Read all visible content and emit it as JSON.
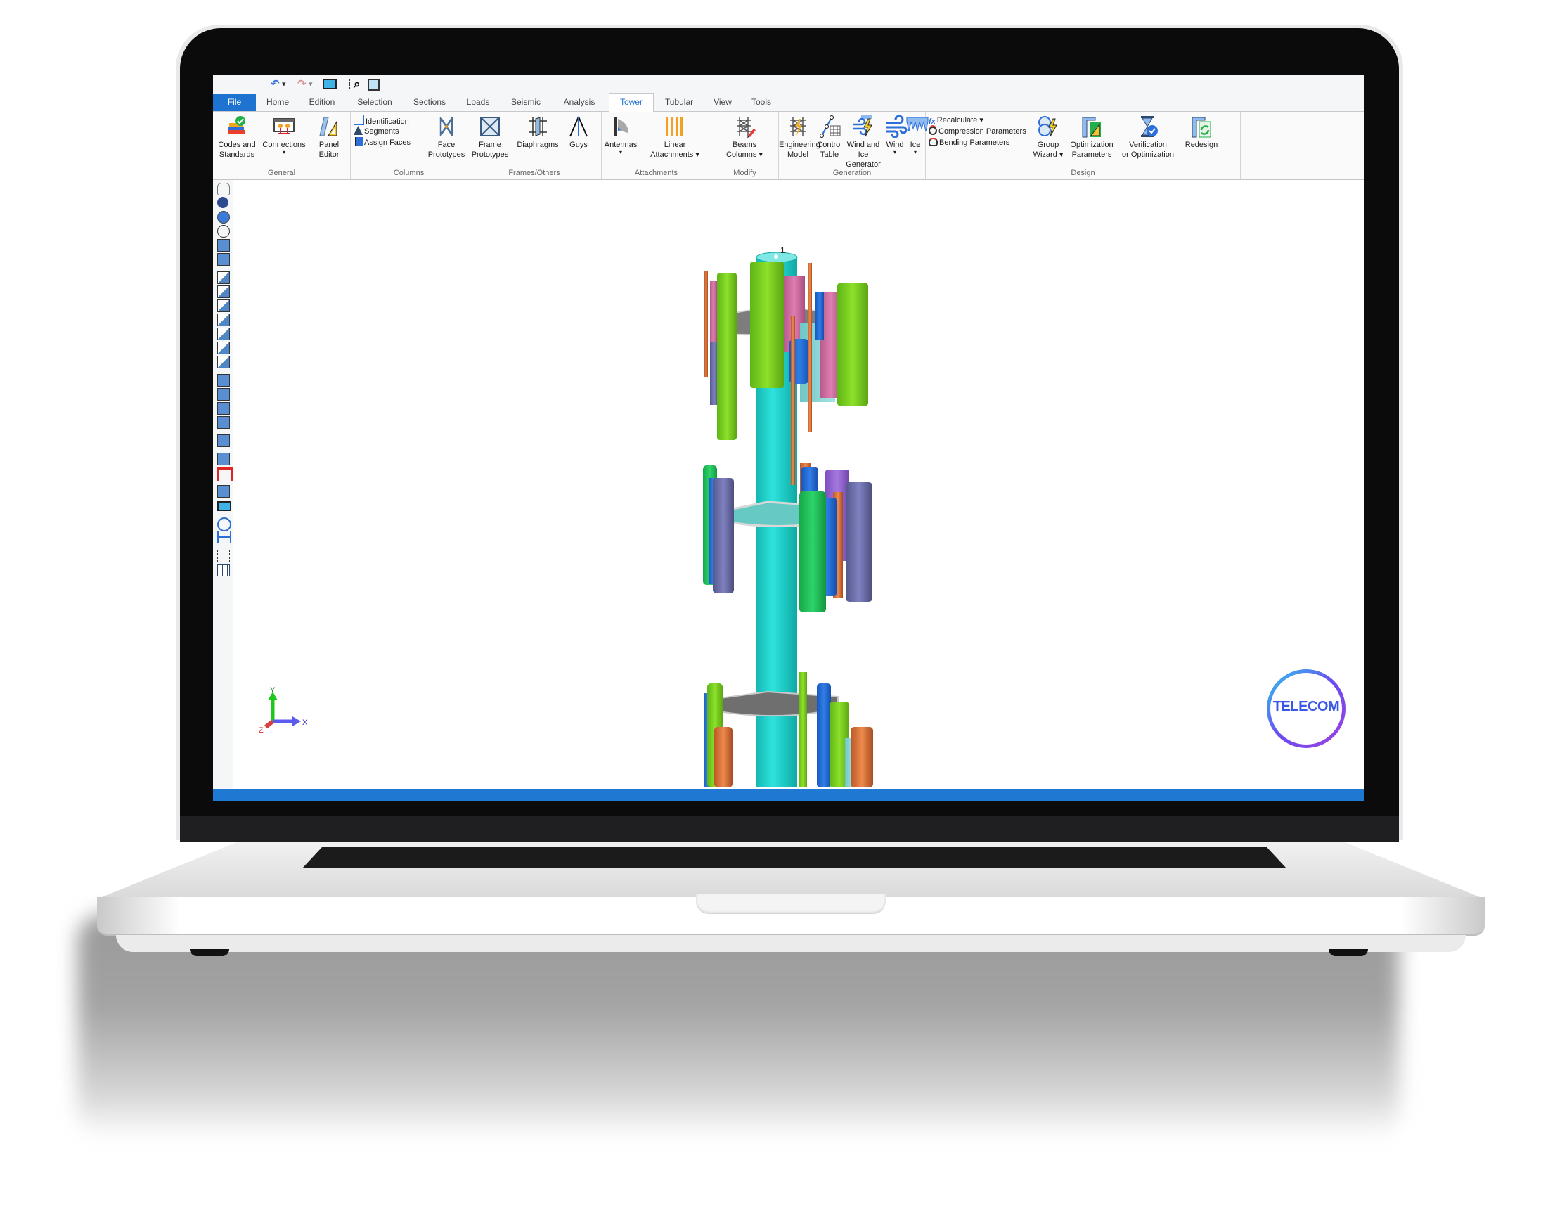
{
  "quick_access": {
    "items": [
      {
        "icon": "undo-icon",
        "glyph": "↶"
      },
      {
        "icon": "undo-dropdown-icon",
        "glyph": "▾"
      },
      {
        "icon": "redo-icon",
        "glyph": "↷"
      },
      {
        "icon": "redo-dropdown-icon",
        "glyph": "▾"
      },
      {
        "icon": "monitor-icon",
        "glyph": "▭"
      },
      {
        "icon": "select-region-icon",
        "glyph": "⬚"
      },
      {
        "icon": "search-icon",
        "glyph": "⌕"
      },
      {
        "icon": "zoom-window-icon",
        "glyph": "▣"
      }
    ]
  },
  "tabs": [
    {
      "label": "File"
    },
    {
      "label": "Home"
    },
    {
      "label": "Edition"
    },
    {
      "label": "Selection"
    },
    {
      "label": "Sections"
    },
    {
      "label": "Loads"
    },
    {
      "label": "Seismic"
    },
    {
      "label": "Analysis"
    },
    {
      "label": "Tower",
      "active": true
    },
    {
      "label": "Tubular"
    },
    {
      "label": "View"
    },
    {
      "label": "Tools"
    }
  ],
  "ribbon": {
    "groups": {
      "general": {
        "label": "General",
        "buttons": [
          {
            "label_1": "Codes and",
            "label_2": "Standards"
          },
          {
            "label_1": "Connections",
            "label_2": "▾"
          },
          {
            "label_1": "Panel",
            "label_2": "Editor"
          }
        ]
      },
      "columns": {
        "label": "Columns",
        "small_buttons": [
          "Identification",
          "Segments",
          "Assign Faces"
        ],
        "buttons": [
          {
            "label_1": "Face",
            "label_2": "Prototypes"
          }
        ]
      },
      "frames": {
        "label": "Frames/Others",
        "buttons": [
          {
            "label_1": "Frame",
            "label_2": "Prototypes"
          },
          {
            "label_1": "Diaphragms",
            "label_2": ""
          },
          {
            "label_1": "Guys",
            "label_2": ""
          }
        ]
      },
      "attachments": {
        "label": "Attachments",
        "buttons": [
          {
            "label_1": "Antennas",
            "label_2": "▾"
          },
          {
            "label_1": "Linear",
            "label_2": "Attachments ▾"
          }
        ]
      },
      "modify": {
        "label": "Modify",
        "buttons": [
          {
            "label_1": "Beams",
            "label_2": "Columns ▾"
          }
        ]
      },
      "generation": {
        "label": "Generation",
        "buttons": [
          {
            "label_1": "Engineering",
            "label_2": "Model"
          },
          {
            "label_1": "Control",
            "label_2": "Table"
          },
          {
            "label_1": "Wind and Ice",
            "label_2": "Generator"
          },
          {
            "label_1": "Wind",
            "label_2": "▾"
          },
          {
            "label_1": "Ice",
            "label_2": "▾"
          }
        ]
      },
      "design": {
        "label": "Design",
        "small_buttons": [
          "Recalculate ▾",
          "Compression Parameters",
          "Bending Parameters"
        ],
        "buttons": [
          {
            "label_1": "Group",
            "label_2": "Wizard ▾"
          },
          {
            "label_1": "Optimization",
            "label_2": "Parameters"
          },
          {
            "label_1": "Verification",
            "label_2": "or Optimization"
          },
          {
            "label_1": "Redesign",
            "label_2": ""
          }
        ]
      }
    }
  },
  "left_toolbar": {
    "tools": [
      "pan",
      "globe-view",
      "orbit",
      "rotate",
      "zoom-window",
      "zoom-extents",
      "view-front",
      "view-back",
      "view-right",
      "view-left",
      "view-top",
      "view-bottom",
      "view-iso",
      "fit-all",
      "visibility",
      "section-view",
      "clip-view",
      "save-view",
      "hide",
      "show-red",
      "frame-view",
      "display",
      "center",
      "dimension",
      "select-box",
      "grid"
    ]
  },
  "viewport": {
    "node_label": "1",
    "axes": {
      "x": "X",
      "y": "Y",
      "z": "Z"
    },
    "logo_text": "TELECOM"
  },
  "colors": {
    "accent": "#1e73d1",
    "status_bar": "#1f78d1",
    "mast": "#16cfc9",
    "antenna_green": "#7ed321",
    "antenna_pink": "#d86fa8",
    "antenna_blue": "#1e6fd6",
    "antenna_orange": "#e07a3a",
    "antenna_slate": "#6c6ea8",
    "antenna_purple": "#9a6ad6",
    "platform_gray": "#7a7a7a"
  }
}
